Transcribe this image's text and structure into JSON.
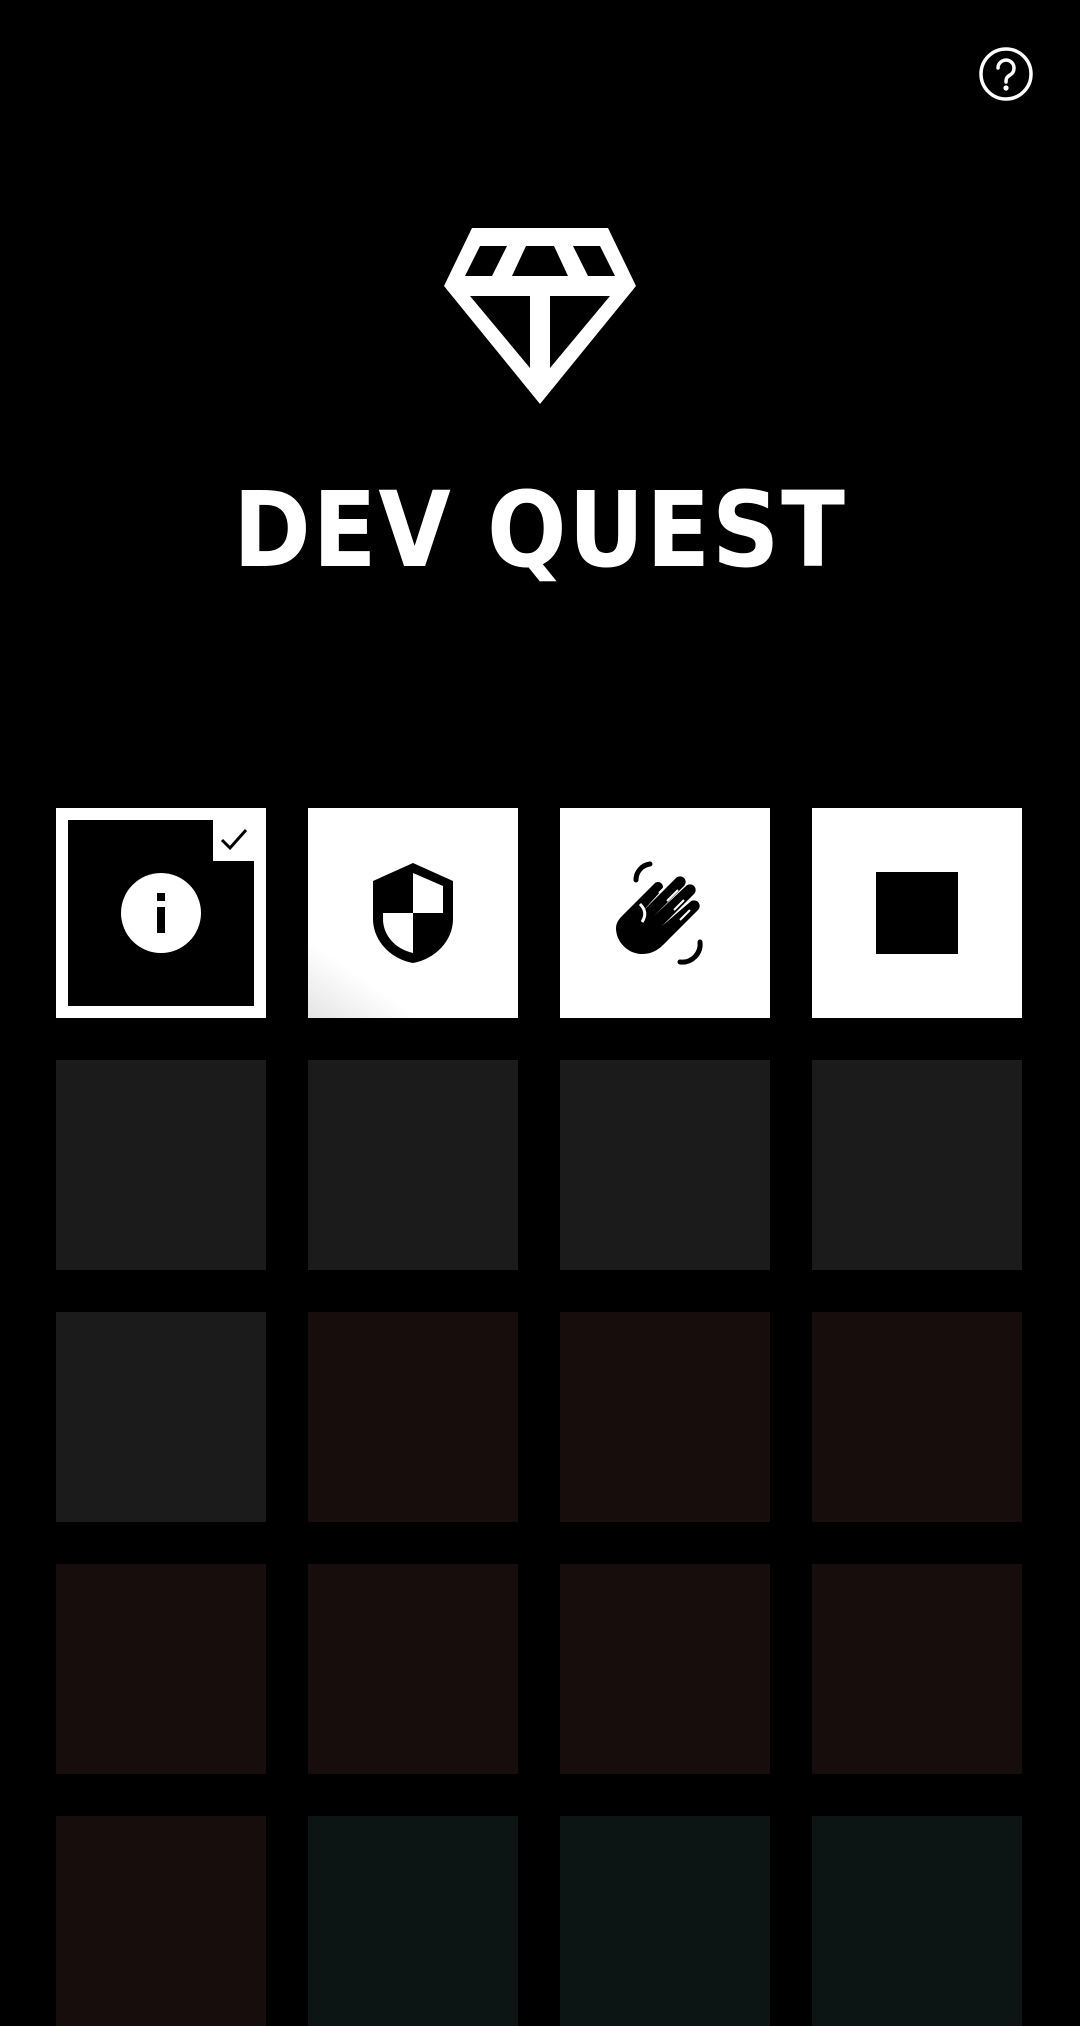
{
  "app": {
    "title": "DEV QUEST"
  },
  "header": {
    "help_icon": "help-circle-icon",
    "logo_icon": "diamond-icon"
  },
  "colors": {
    "background": "#000000",
    "foreground": "#ffffff",
    "locked_gray": "#1b1b1b",
    "locked_red": "#160d0c",
    "locked_teal": "#0c1514"
  },
  "quests": [
    {
      "id": "info",
      "icon": "info-icon",
      "state": "completed-selected"
    },
    {
      "id": "security",
      "icon": "shield-icon",
      "state": "unlocked"
    },
    {
      "id": "gestures",
      "icon": "waving-hand-icon",
      "state": "unlocked"
    },
    {
      "id": "stop",
      "icon": "stop-icon",
      "state": "unlocked"
    },
    {
      "id": "locked-1",
      "icon": "",
      "state": "locked-gray"
    },
    {
      "id": "locked-2",
      "icon": "",
      "state": "locked-gray"
    },
    {
      "id": "locked-3",
      "icon": "",
      "state": "locked-gray"
    },
    {
      "id": "locked-4",
      "icon": "",
      "state": "locked-gray"
    },
    {
      "id": "locked-5",
      "icon": "",
      "state": "locked-gray"
    },
    {
      "id": "locked-6",
      "icon": "",
      "state": "locked-red"
    },
    {
      "id": "locked-7",
      "icon": "",
      "state": "locked-red"
    },
    {
      "id": "locked-8",
      "icon": "",
      "state": "locked-red"
    },
    {
      "id": "locked-9",
      "icon": "",
      "state": "locked-red"
    },
    {
      "id": "locked-10",
      "icon": "",
      "state": "locked-red"
    },
    {
      "id": "locked-11",
      "icon": "",
      "state": "locked-red"
    },
    {
      "id": "locked-12",
      "icon": "",
      "state": "locked-red"
    },
    {
      "id": "locked-13",
      "icon": "",
      "state": "locked-red"
    },
    {
      "id": "locked-14",
      "icon": "",
      "state": "locked-teal"
    },
    {
      "id": "locked-15",
      "icon": "",
      "state": "locked-teal"
    },
    {
      "id": "locked-16",
      "icon": "",
      "state": "locked-teal"
    }
  ]
}
